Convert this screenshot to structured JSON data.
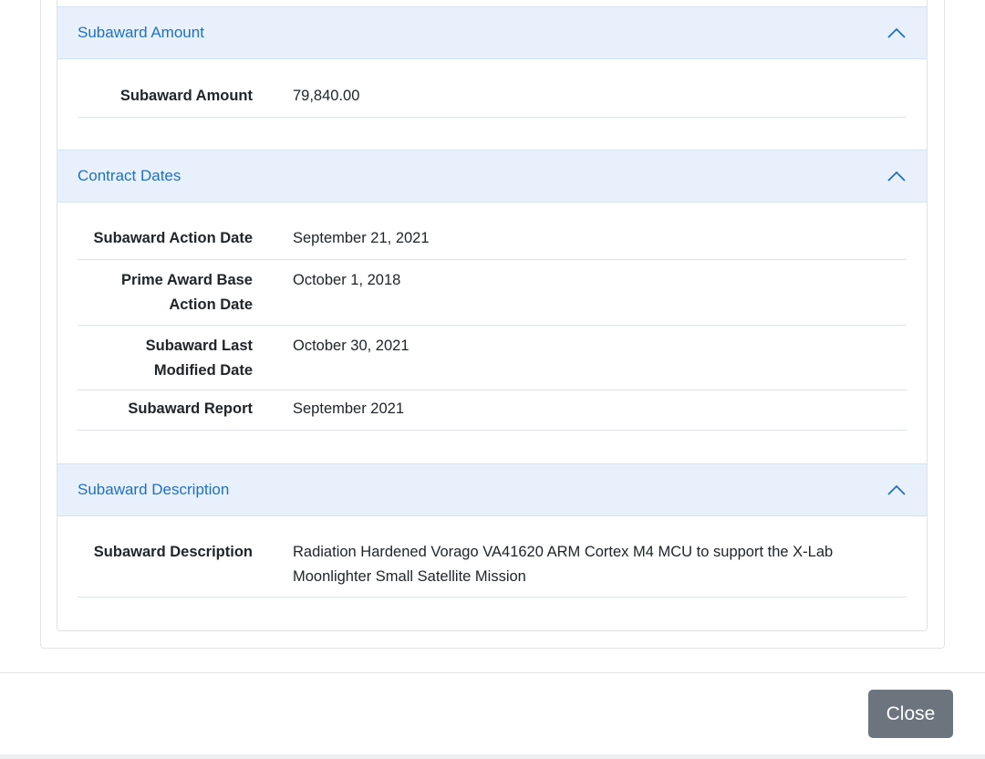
{
  "sections": [
    {
      "title": "Subaward Amount",
      "rows": [
        {
          "label": "Subaward Amount",
          "value": "79,840.00"
        }
      ]
    },
    {
      "title": "Contract Dates",
      "rows": [
        {
          "label": "Subaward Action Date",
          "value": "September 21, 2021"
        },
        {
          "label": "Prime Award Base Action Date",
          "value": "October 1, 2018"
        },
        {
          "label": "Subaward Last Modified Date",
          "value": "October 30, 2021"
        },
        {
          "label": "Subaward Report",
          "value": "September 2021"
        }
      ]
    },
    {
      "title": "Subaward Description",
      "rows": [
        {
          "label": "Subaward Description",
          "value": "Radiation Hardened Vorago VA41620 ARM Cortex M4 MCU to support the X-Lab Moonlighter Small Satellite Mission"
        }
      ]
    }
  ],
  "icons": {
    "collapse": "chevron-up-icon"
  },
  "footer": {
    "close_label": "Close"
  }
}
